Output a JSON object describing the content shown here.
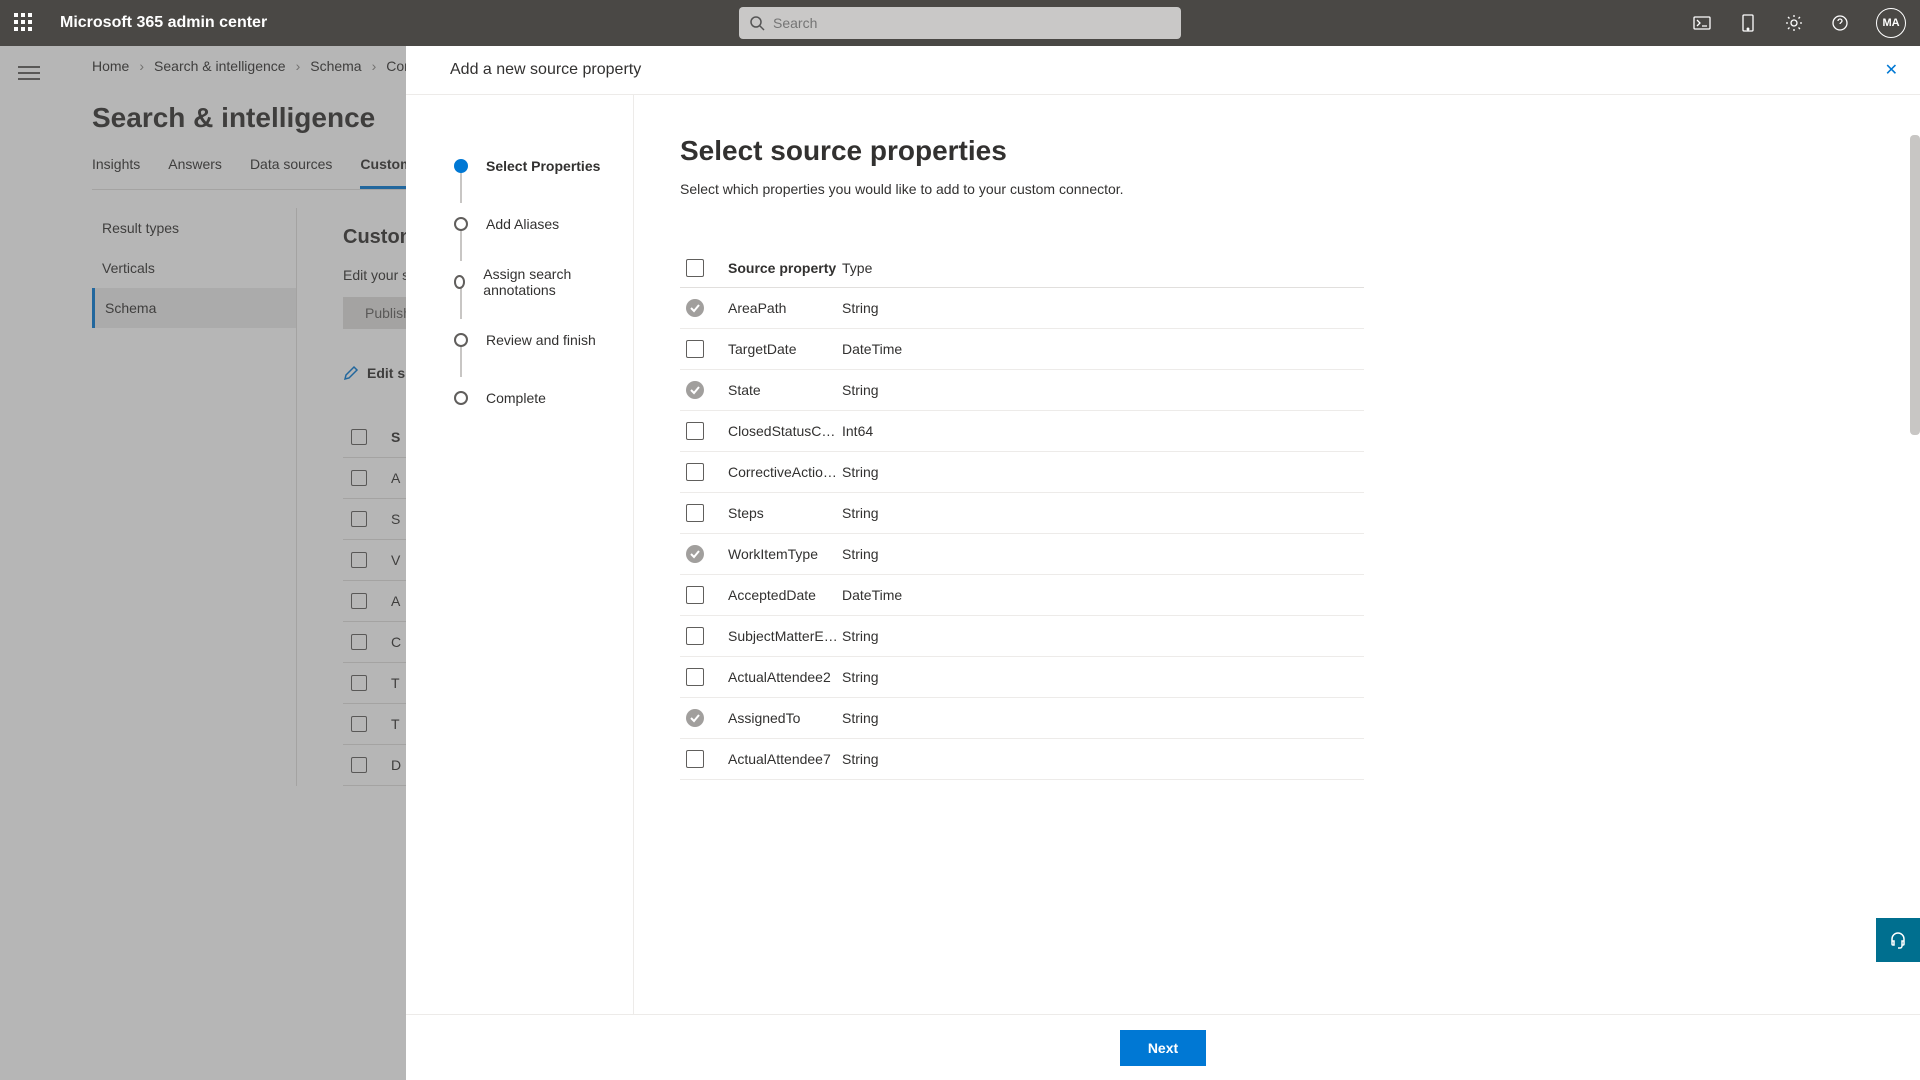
{
  "header": {
    "title": "Microsoft 365 admin center",
    "search_placeholder": "Search",
    "avatar_initials": "MA"
  },
  "breadcrumb": [
    "Home",
    "Search & intelligence",
    "Schema",
    "Conn"
  ],
  "page": {
    "title": "Search & intelligence",
    "tabs": [
      "Insights",
      "Answers",
      "Data sources",
      "Customiz"
    ],
    "active_tab": 3
  },
  "sidenav": {
    "items": [
      "Result types",
      "Verticals",
      "Schema"
    ],
    "selected": 2
  },
  "customize": {
    "heading": "Customi",
    "sub": "Edit your se",
    "publish": "Publish",
    "edit": "Edit s",
    "th": "S",
    "rows": [
      "A",
      "S",
      "V",
      "A",
      "C",
      "T",
      "T",
      "D"
    ]
  },
  "panel": {
    "title": "Add a new source property",
    "steps": [
      "Select Properties",
      "Add Aliases",
      "Assign search annotations",
      "Review and finish",
      "Complete"
    ],
    "active_step": 0,
    "main_title": "Select source properties",
    "main_sub": "Select which properties you would like to add to your custom connector.",
    "columns": {
      "c1": "Source property",
      "c2": "Type"
    },
    "rows": [
      {
        "name": "AreaPath",
        "type": "String",
        "locked": true
      },
      {
        "name": "TargetDate",
        "type": "DateTime",
        "locked": false
      },
      {
        "name": "State",
        "type": "String",
        "locked": true
      },
      {
        "name": "ClosedStatusCode",
        "type": "Int64",
        "locked": false
      },
      {
        "name": "CorrectiveAction…",
        "type": "String",
        "locked": false
      },
      {
        "name": "Steps",
        "type": "String",
        "locked": false
      },
      {
        "name": "WorkItemType",
        "type": "String",
        "locked": true
      },
      {
        "name": "AcceptedDate",
        "type": "DateTime",
        "locked": false
      },
      {
        "name": "SubjectMatterEx…",
        "type": "String",
        "locked": false
      },
      {
        "name": "ActualAttendee2",
        "type": "String",
        "locked": false
      },
      {
        "name": "AssignedTo",
        "type": "String",
        "locked": true
      },
      {
        "name": "ActualAttendee7",
        "type": "String",
        "locked": false
      }
    ],
    "next": "Next"
  }
}
